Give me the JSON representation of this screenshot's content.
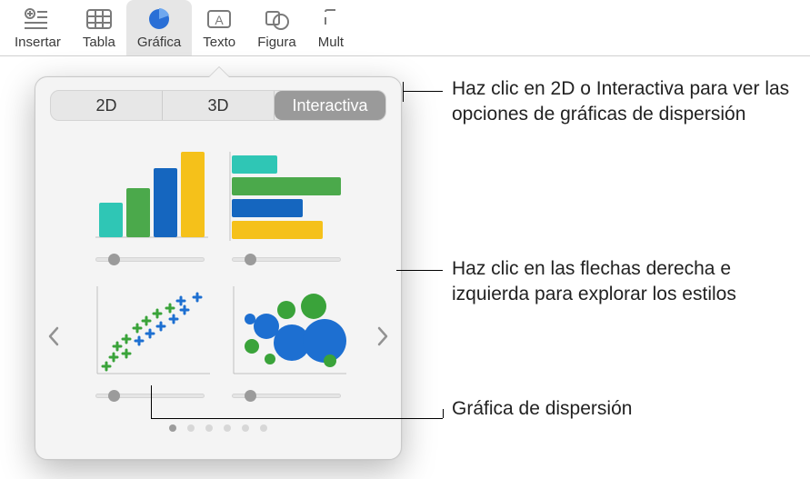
{
  "toolbar": {
    "items": [
      {
        "label": "Insertar"
      },
      {
        "label": "Tabla"
      },
      {
        "label": "Gráfica"
      },
      {
        "label": "Texto"
      },
      {
        "label": "Figura"
      },
      {
        "label": "Mult"
      }
    ]
  },
  "popover": {
    "tabs": {
      "tab2d": "2D",
      "tab3d": "3D",
      "tabInteractive": "Interactiva"
    },
    "charts": {
      "barVertical": "bar-chart-vertical",
      "barHorizontal": "bar-chart-horizontal",
      "scatter": "scatter-chart",
      "bubble": "bubble-chart"
    }
  },
  "callouts": {
    "tabs": "Haz clic en 2D o Interactiva para ver las opciones de gráficas de dispersión",
    "arrows": "Haz clic en las flechas derecha e izquierda para explorar los estilos",
    "scatter": "Gráfica de dispersión"
  }
}
